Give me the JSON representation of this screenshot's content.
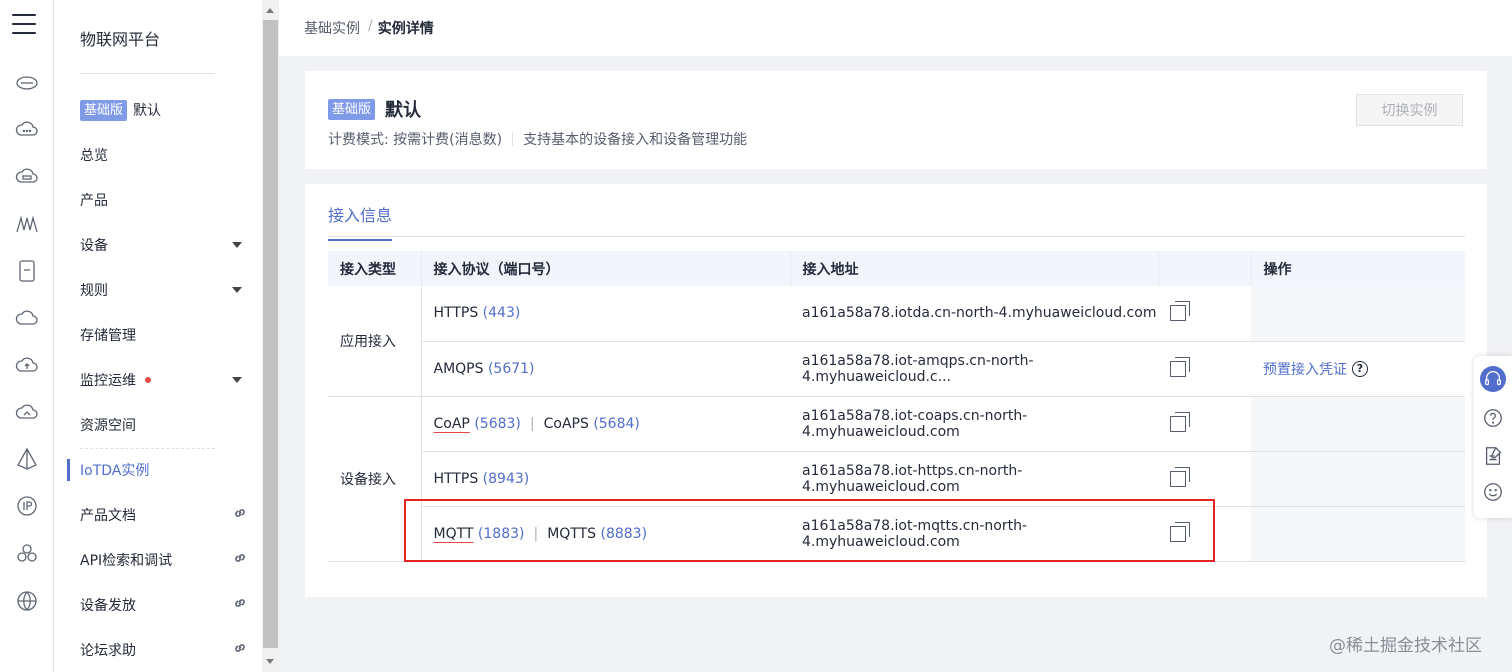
{
  "sidebar": {
    "title": "物联网平台",
    "instance_badge": "基础版",
    "instance_name": "默认",
    "items": [
      {
        "label": "总览"
      },
      {
        "label": "产品"
      },
      {
        "label": "设备"
      },
      {
        "label": "规则"
      },
      {
        "label": "存储管理"
      },
      {
        "label": "监控运维"
      },
      {
        "label": "资源空间"
      },
      {
        "label": "IoTDA实例"
      },
      {
        "label": "产品文档"
      },
      {
        "label": "API检索和调试"
      },
      {
        "label": "设备发放"
      },
      {
        "label": "论坛求助"
      }
    ]
  },
  "breadcrumb": {
    "parent": "基础实例",
    "separator": "/",
    "current": "实例详情"
  },
  "instance": {
    "badge": "基础版",
    "name": "默认",
    "billing": "计费模式: 按需计费(消息数)",
    "description": "支持基本的设备接入和设备管理功能",
    "switch_button": "切换实例"
  },
  "access": {
    "tab": "接入信息",
    "columns": [
      "接入类型",
      "接入协议（端口号）",
      "接入地址",
      "",
      "操作"
    ],
    "groups": {
      "app": "应用接入",
      "device": "设备接入"
    },
    "rows": [
      {
        "protocols": [
          {
            "name": "HTTPS",
            "port": "(443)"
          }
        ],
        "address": "a161a58a78.iotda.cn-north-4.myhuaweicloud.com"
      },
      {
        "protocols": [
          {
            "name": "AMQPS",
            "port": "(5671)"
          }
        ],
        "address": "a161a58a78.iot-amqps.cn-north-4.myhuaweicloud.c...",
        "operation": "预置接入凭证"
      },
      {
        "protocols": [
          {
            "name": "CoAP",
            "port": "(5683)"
          },
          {
            "name": "CoAPS",
            "port": "(5684)"
          }
        ],
        "address": "a161a58a78.iot-coaps.cn-north-4.myhuaweicloud.com"
      },
      {
        "protocols": [
          {
            "name": "HTTPS",
            "port": "(8943)"
          }
        ],
        "address": "a161a58a78.iot-https.cn-north-4.myhuaweicloud.com"
      },
      {
        "protocols": [
          {
            "name": "MQTT",
            "port": "(1883)"
          },
          {
            "name": "MQTTS",
            "port": "(8883)"
          }
        ],
        "address": "a161a58a78.iot-mqtts.cn-north-4.myhuaweicloud.com"
      }
    ],
    "protocol_separator": "|"
  },
  "colors": {
    "accent": "#526ecc",
    "badge": "#7f9be8",
    "highlight": "#e32424",
    "page_bg": "#f1f2f5"
  },
  "watermark": "@稀土掘金技术社区"
}
